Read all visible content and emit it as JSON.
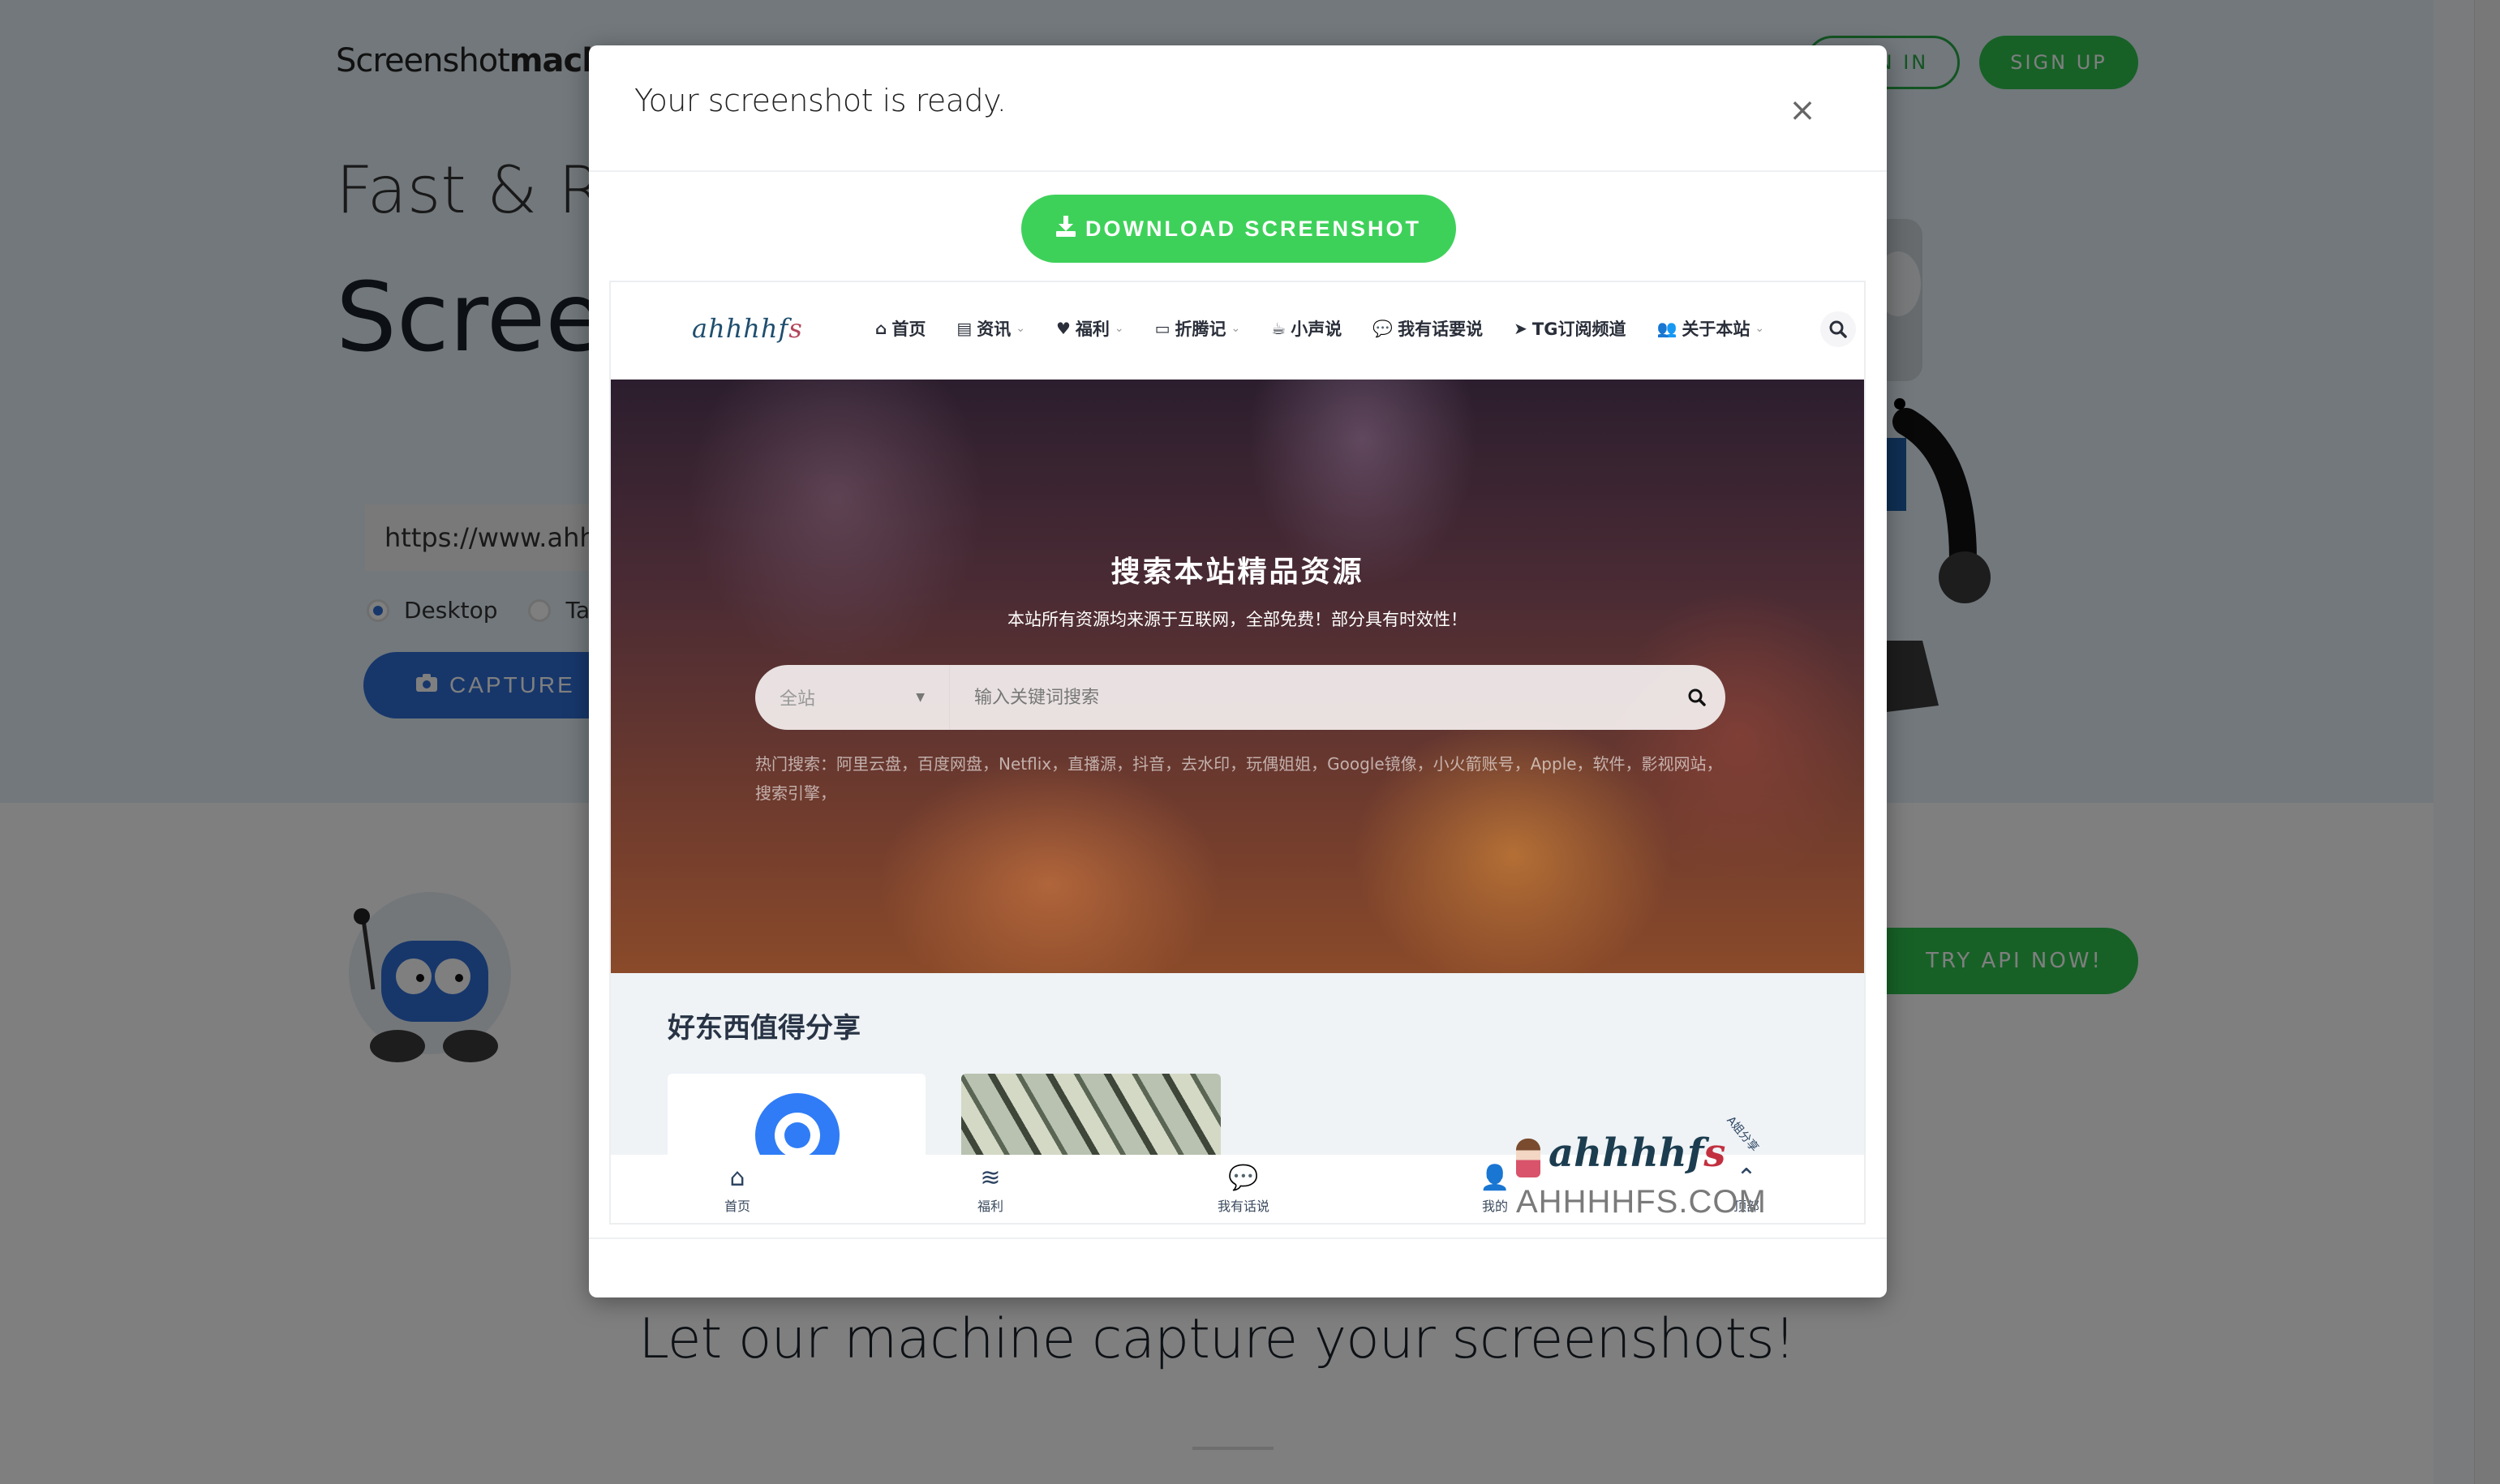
{
  "background_page": {
    "logo_light": "Screenshot",
    "logo_bold": "machine",
    "signin_label": "SIGN IN",
    "signup_label": "SIGN UP",
    "hero_subtitle": "Fast & Reliable",
    "hero_title": "Screenshots",
    "url_input_value": "https://www.ahhhhfs.com",
    "device_options": [
      {
        "label": "Desktop",
        "selected": true
      },
      {
        "label": "Tablet",
        "selected": false
      }
    ],
    "capture_label": "CAPTURE",
    "try_api_label": "TRY API NOW!",
    "bottom_heading": "Let our machine capture your screenshots!"
  },
  "modal": {
    "title": "Your screenshot is ready.",
    "close_icon": "×",
    "download_icon": "download-icon",
    "download_label": "DOWNLOAD SCREENSHOT"
  },
  "captured_site": {
    "logo_main": "ahhhhf",
    "logo_accent": "s",
    "nav": [
      {
        "icon": "⌂",
        "label": "首页",
        "dropdown": false
      },
      {
        "icon": "▤",
        "label": "资讯",
        "dropdown": true
      },
      {
        "icon": "♥",
        "label": "福利",
        "dropdown": true
      },
      {
        "icon": "▭",
        "label": "折腾记",
        "dropdown": true
      },
      {
        "icon": "☕",
        "label": "小声说",
        "dropdown": false
      },
      {
        "icon": "💬",
        "label": "我有话要说",
        "dropdown": false
      },
      {
        "icon": "➤",
        "label": "TG订阅频道",
        "dropdown": false
      },
      {
        "icon": "👥",
        "label": "关于本站",
        "dropdown": true
      }
    ],
    "chevron": "⌄",
    "hero_heading": "搜索本站精品资源",
    "hero_text": "本站所有资源均来源于互联网，全部免费！部分具有时效性！",
    "search_scope": "全站",
    "search_placeholder": "输入关键词搜索",
    "hot_search_label": "热门搜索：",
    "hot_search_terms": "阿里云盘，百度网盘，Netflix，直播源，抖音，去水印，玩偶姐姐，Google镜像，小火箭账号，Apple，软件，影视网站，搜索引擎，",
    "section_title": "好东西值得分享",
    "tabbar": [
      {
        "icon": "⌂",
        "label": "首页"
      },
      {
        "icon": "≋",
        "label": "福利"
      },
      {
        "icon": "💬",
        "label": "我有话说"
      },
      {
        "icon": "👤",
        "label": "我的"
      },
      {
        "icon": "⌃",
        "label": "顶部"
      }
    ],
    "watermark_logo": "ahhhhf",
    "watermark_logo_accent": "s",
    "watermark_tag": "A姐分享",
    "watermark_domain": "AHHHHFS.COM"
  },
  "colors": {
    "download_green": "#3ed15a",
    "brand_green": "#2ec34f",
    "capture_blue": "#2f6fd6",
    "overlay": "rgba(0,0,0,0.5)"
  }
}
